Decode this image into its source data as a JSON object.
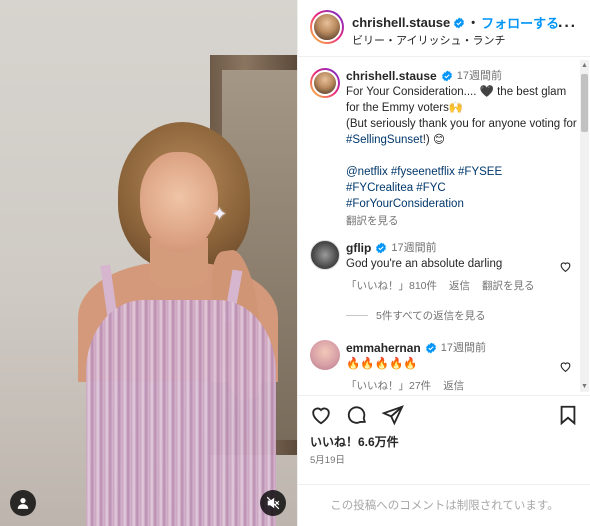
{
  "header": {
    "username": "chrishell.stause",
    "dot": "•",
    "follow_label": "フォローする",
    "subtitle": "ビリー・アイリッシュ・ランチ",
    "more_label": "···"
  },
  "caption": {
    "username": "chrishell.stause",
    "time": "17週間前",
    "line1": "For Your Consideration.... 🖤 the best glam for the Emmy voters🙌",
    "line2_prefix": "(But seriously thank you for anyone voting for ",
    "line2_link": "#SellingSunset",
    "line2_suffix": "!) 😊",
    "tags_line1": "@netflix #fyseenetflix #FYSEE",
    "tags_line2": "#FYCrealitea #FYC",
    "tags_line3": "#ForYourConsideration",
    "see_translation": "翻訳を見る"
  },
  "comments": [
    {
      "username": "gflip",
      "time": "17週間前",
      "text": "God you're an absolute darling",
      "likes": "「いいね！」810件",
      "reply": "返信",
      "translate": "翻訳を見る"
    },
    {
      "username": "emmahernan",
      "time": "17週間前",
      "text": "🔥🔥🔥🔥🔥",
      "likes": "「いいね！」27件",
      "reply": "返信"
    }
  ],
  "view_replies": "5件すべての返信を見る",
  "post": {
    "likes": "いいね！6.6万件",
    "date": "5月19日",
    "restricted": "この投稿へのコメントは制限されています。"
  },
  "colors": {
    "follow": "#0095f6",
    "link": "#00376b",
    "muted": "#737373",
    "verified": "#0095f6"
  },
  "icons": [
    "verified-badge-icon",
    "more-icon",
    "heart-icon",
    "comment-icon",
    "share-icon",
    "bookmark-icon",
    "user-tag-icon",
    "mute-icon"
  ]
}
